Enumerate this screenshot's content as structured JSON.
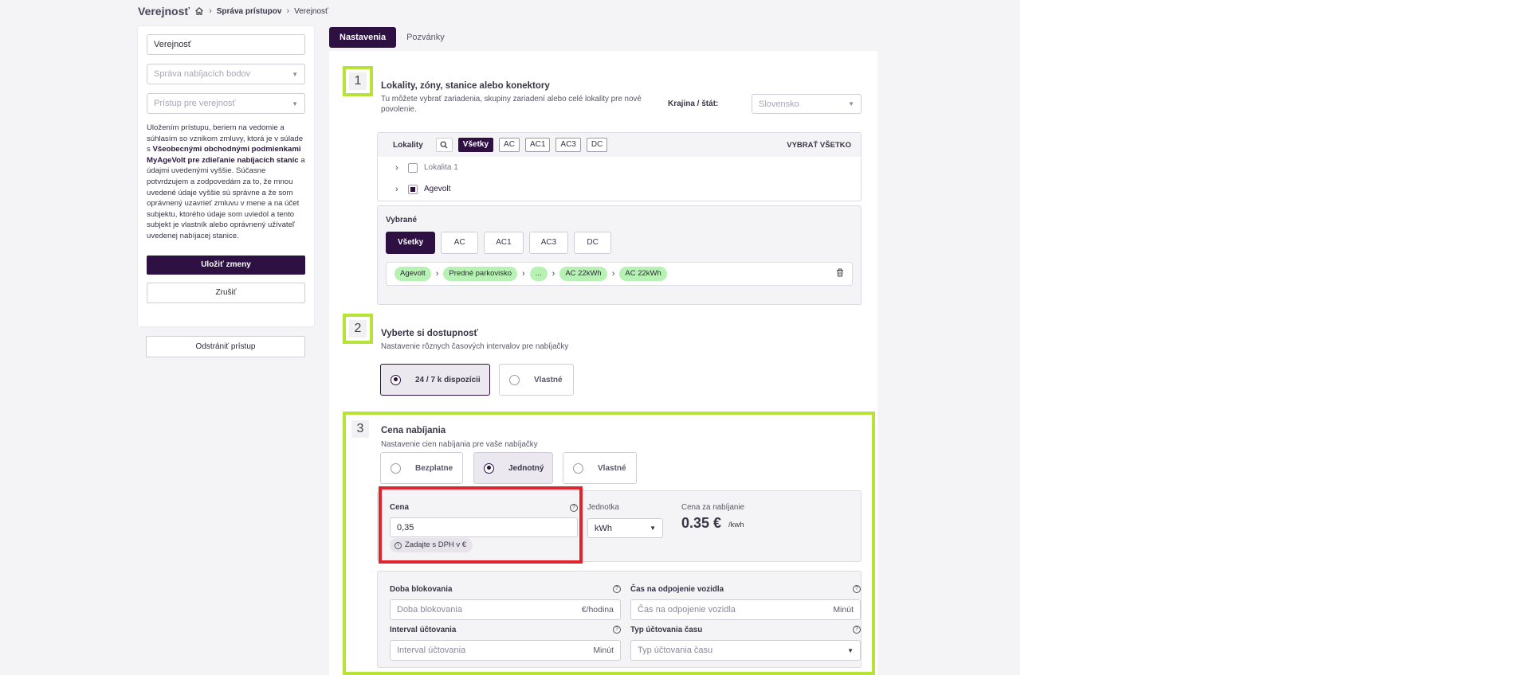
{
  "header": {
    "title": "Verejnosť",
    "breadcrumb": [
      "Správa prístupov",
      "Verejnosť"
    ]
  },
  "left_panel": {
    "name_value": "Verejnosť",
    "charging_points_placeholder": "Správa nabíjacích bodov",
    "access_placeholder": "Prístup pre verejnosť",
    "terms_part1": "Uložením prístupu, beriem na vedomie a súhlasím so vznikom zmluvy, ktorá je v súlade s ",
    "terms_bold": "Všeobecnými obchodnými podmienkami MyAgeVolt pre zdieľanie nabíjacích staníc",
    "terms_part2": " a údajmi uvedenými vyššie. Súčasne potvrdzujem a zodpovedám za to, že mnou uvedené údaje vyššie sú správne a že som oprávnený uzavrieť zmluvu v mene a na účet subjektu, ktorého údaje som uviedol a tento subjekt je vlastník alebo oprávnený užívateľ uvedenej nabíjacej stanice.",
    "save_label": "Uložiť zmeny",
    "cancel_label": "Zrušiť",
    "remove_label": "Odstrániť prístup"
  },
  "tabs": [
    {
      "label": "Nastavenia",
      "active": true
    },
    {
      "label": "Pozvánky",
      "active": false
    }
  ],
  "section1": {
    "number": "1",
    "title": "Lokality, zóny, stanice alebo konektory",
    "subtitle": "Tu môžete vybrať zariadenia, skupiny zariadení alebo celé lokality pre nové povolenie.",
    "country_label": "Krajina / štát:",
    "country_value": "Slovensko",
    "locations_label": "Lokality",
    "filters": [
      "Všetky",
      "AC",
      "AC1",
      "AC3",
      "DC"
    ],
    "select_all": "VYBRAŤ VŠETKO",
    "tree": [
      {
        "label": "Lokalita 1",
        "state": "unchecked"
      },
      {
        "label": "Agevolt",
        "state": "partial"
      }
    ],
    "selected_label": "Vybrané",
    "selected_filters": [
      "Všetky",
      "AC",
      "AC1",
      "AC3",
      "DC"
    ],
    "path": [
      "Agevolt",
      "Predné parkovisko",
      "...",
      "AC 22kWh",
      "AC 22kWh"
    ]
  },
  "section2": {
    "number": "2",
    "title": "Vyberte si dostupnosť",
    "subtitle": "Nastavenie rôznych časových intervalov pre nabíjačky",
    "options": [
      {
        "label": "24 / 7 k dispozícii",
        "selected": true
      },
      {
        "label": "Vlastné",
        "selected": false
      }
    ]
  },
  "section3": {
    "number": "3",
    "title": "Cena nabíjania",
    "subtitle": "Nastavenie cien nabíjania pre vaše nabíjačky",
    "options": [
      {
        "label": "Bezplatne",
        "selected": false
      },
      {
        "label": "Jednotný",
        "selected": true
      },
      {
        "label": "Vlastné",
        "selected": false
      }
    ],
    "price_label": "Cena",
    "price_value": "0,35",
    "price_hint": "Zadajte s DPH v €",
    "unit_label": "Jednotka",
    "unit_value": "kWh",
    "total_label": "Cena za nabíjanie",
    "total_value": "0.35 €",
    "total_unit": "/kwh",
    "block_label": "Doba blokovania",
    "block_placeholder": "Doba blokovania",
    "block_suffix": "€/hodina",
    "disconnect_label": "Čas na odpojenie vozidla",
    "disconnect_placeholder": "Čas na odpojenie vozidla",
    "disconnect_suffix": "Minút",
    "interval_label": "Interval účtovania",
    "interval_placeholder": "Interval účtovania",
    "interval_suffix": "Minút",
    "billing_type_label": "Typ účtovania času",
    "billing_type_placeholder": "Typ účtovania času"
  },
  "colors": {
    "primary": "#2e1043",
    "highlight_green": "#b6e335",
    "highlight_red": "#e0242d",
    "pill_green": "#b7f2b4"
  }
}
